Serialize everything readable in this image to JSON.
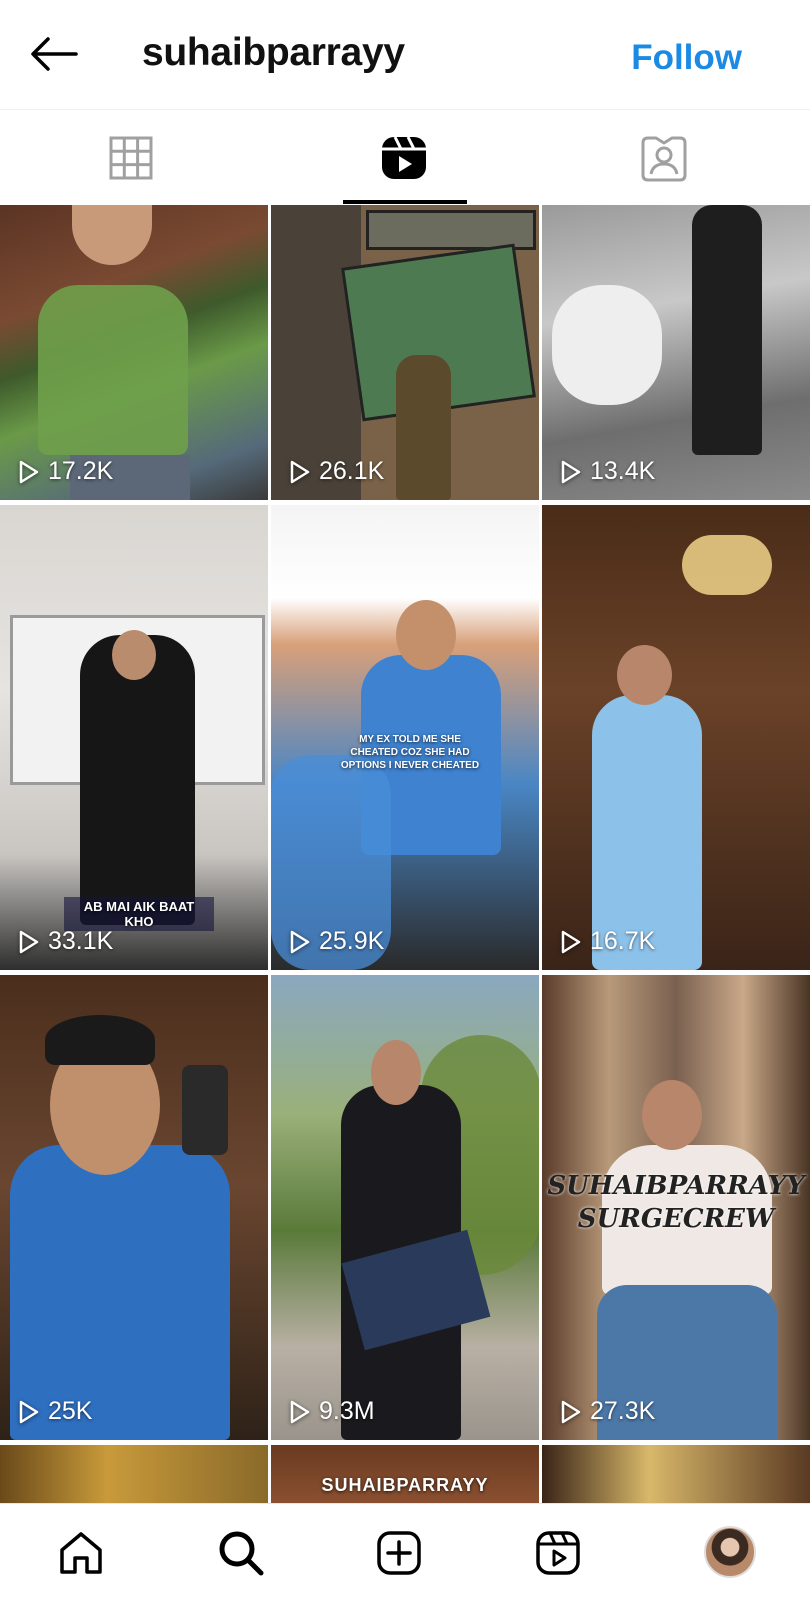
{
  "header": {
    "username": "suhaibparrayy",
    "follow_label": "Follow",
    "back_icon": "arrow-left-icon"
  },
  "tabs": [
    {
      "name": "posts",
      "icon": "grid-icon",
      "active": false
    },
    {
      "name": "reels",
      "icon": "reels-icon",
      "active": true
    },
    {
      "name": "tagged",
      "icon": "tagged-person-icon",
      "active": false
    }
  ],
  "reels": [
    {
      "views": "17.2K",
      "overlay": ""
    },
    {
      "views": "26.1K",
      "overlay": ""
    },
    {
      "views": "13.4K",
      "overlay": ""
    },
    {
      "views": "33.1K",
      "overlay": "AB MAI AIK BAAT KHO"
    },
    {
      "views": "25.9K",
      "overlay": "MY EX TOLD ME SHE CHEATED COZ SHE HAD OPTIONS I NEVER CHEATED"
    },
    {
      "views": "16.7K",
      "overlay": ""
    },
    {
      "views": "25K",
      "overlay": ""
    },
    {
      "views": "9.3M",
      "overlay": ""
    },
    {
      "views": "27.3K",
      "overlay": "SUHAIBPARRAYY SURGECREW"
    },
    {
      "views": "",
      "overlay": ""
    },
    {
      "views": "",
      "overlay": "SUHAIBPARRAYY"
    },
    {
      "views": "",
      "overlay": ""
    }
  ],
  "bottom_nav": [
    {
      "name": "home",
      "icon": "home-icon"
    },
    {
      "name": "search",
      "icon": "search-icon"
    },
    {
      "name": "create",
      "icon": "add-square-icon"
    },
    {
      "name": "reels",
      "icon": "reels-icon"
    },
    {
      "name": "profile",
      "icon": "profile-avatar"
    }
  ],
  "colors": {
    "follow_blue": "#1a8ae4",
    "text": "#111111",
    "divider": "#efefef"
  }
}
